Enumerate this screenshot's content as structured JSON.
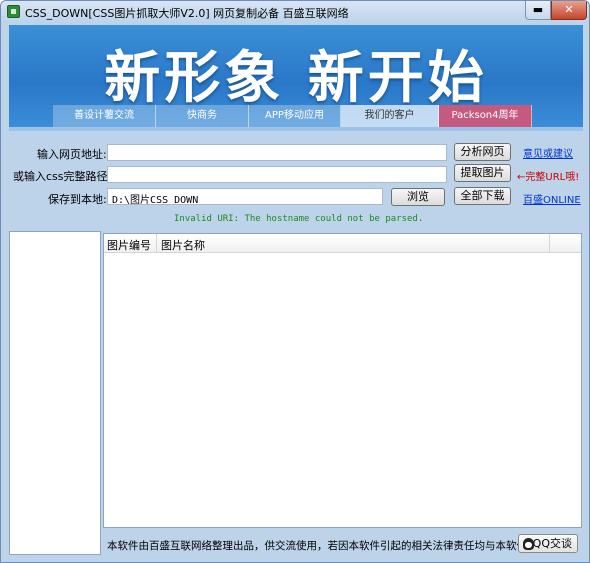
{
  "window": {
    "title": "CSS_DOWN[CSS图片抓取大师V2.0] 网页复制必备 百盛互联网络",
    "minimize": "▬",
    "close": "✕"
  },
  "banner": {
    "headline": "新形象 新开始",
    "nav": [
      "善设计薯交流",
      "快商务",
      "APP移动应用",
      "我们的客户",
      "Packson4周年"
    ]
  },
  "form": {
    "url_label": "输入网页地址:",
    "url_value": "",
    "css_label": "或输入css完整路径:",
    "css_value": "",
    "save_label": "保存到本地:",
    "save_value": "D:\\图片CSS_DOWN",
    "analyze_button": "分析网页",
    "extract_button": "提取图片",
    "browse_button": "浏览",
    "download_all_button": "全部下载",
    "feedback_link": "意见或建议",
    "full_url_hint": "←完整URL哦!",
    "online_link": "百盛ONLINE",
    "status_message": "Invalid URI: The hostname could not be parsed."
  },
  "table": {
    "columns": [
      "图片编号",
      "图片名称"
    ],
    "rows": []
  },
  "footer": {
    "notice": "本软件由百盛互联网络整理出品，供交流使用，若因本软件引起的相关法律责任均与本软件无关!",
    "qq_button": "QQ交谈"
  }
}
